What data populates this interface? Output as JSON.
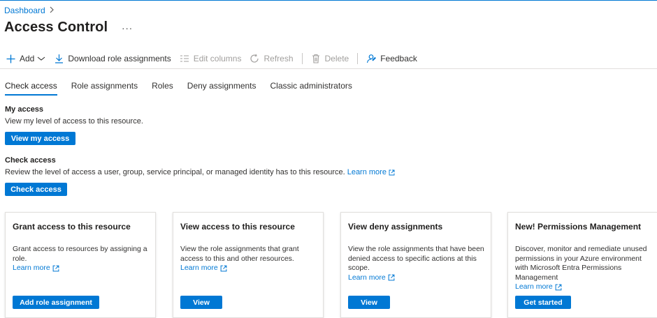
{
  "breadcrumb": {
    "items": [
      "Dashboard"
    ]
  },
  "header": {
    "title": "Access Control",
    "more": "···"
  },
  "toolbar": {
    "add": "Add",
    "download": "Download role assignments",
    "edit_columns": "Edit columns",
    "refresh": "Refresh",
    "delete": "Delete",
    "feedback": "Feedback"
  },
  "tabs": [
    {
      "label": "Check access",
      "active": true
    },
    {
      "label": "Role assignments"
    },
    {
      "label": "Roles"
    },
    {
      "label": "Deny assignments"
    },
    {
      "label": "Classic administrators"
    }
  ],
  "my_access": {
    "title": "My access",
    "desc": "View my level of access to this resource.",
    "button": "View my access"
  },
  "check_access": {
    "title": "Check access",
    "desc": "Review the level of access a user, group, service principal, or managed identity has to this resource.",
    "link": "Learn more",
    "button": "Check access"
  },
  "cards": [
    {
      "title": "Grant access to this resource",
      "body": "Grant access to resources by assigning a role.",
      "link": "Learn more",
      "button": "Add role assignment"
    },
    {
      "title": "View access to this resource",
      "body": "View the role assignments that grant access to this and other resources.",
      "link": "Learn more",
      "button": "View"
    },
    {
      "title": "View deny assignments",
      "body": "View the role assignments that have been denied access to specific actions at this scope.",
      "link": "Learn more",
      "button": "View"
    },
    {
      "title": "New! Permissions Management",
      "body": "Discover, monitor and remediate unused permissions in your Azure environment with Microsoft Entra Permissions Management",
      "link": "Learn more",
      "button": "Get started"
    }
  ],
  "colors": {
    "accent": "#0078d4",
    "disabled": "#a19f9d"
  }
}
